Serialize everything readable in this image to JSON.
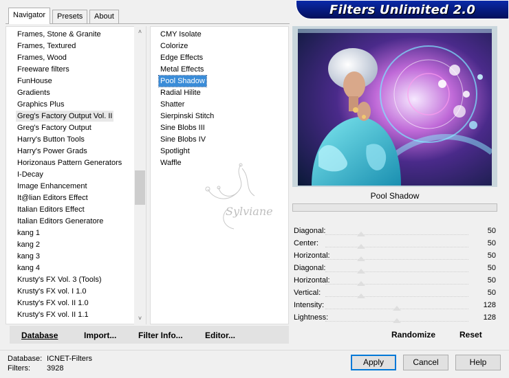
{
  "tabs": [
    {
      "label": "Navigator"
    },
    {
      "label": "Presets"
    },
    {
      "label": "About"
    }
  ],
  "app_title": "Filters Unlimited 2.0",
  "categories": [
    "Frames, Stone & Granite",
    "Frames, Textured",
    "Frames, Wood",
    "Freeware filters",
    "FunHouse",
    "Gradients",
    "Graphics Plus",
    "Greg's Factory Output Vol. II",
    "Greg's Factory Output",
    "Harry's Button Tools",
    "Harry's Power Grads",
    "Horizonaus Pattern Generators",
    "I-Decay",
    "Image Enhancement",
    "It@lian Editors Effect",
    "Italian Editors Effect",
    "Italian Editors Generatore",
    "kang 1",
    "kang 2",
    "kang 3",
    "kang 4",
    "Krusty's FX Vol. 3 (Tools)",
    "Krusty's FX vol. I 1.0",
    "Krusty's FX vol. II 1.0",
    "Krusty's FX vol. II 1.1"
  ],
  "highlighted_category_index": 7,
  "filters": [
    "CMY Isolate",
    "Colorize",
    "Edge Effects",
    "Metal Effects",
    "Pool Shadow",
    "Radial Hilite",
    "Shatter",
    "Sierpinski Stitch",
    "Sine Blobs III",
    "Sine Blobs IV",
    "Spotlight",
    "Waffle"
  ],
  "selected_filter_index": 4,
  "watermark_text": "Sylviane",
  "preview": {
    "filter_name": "Pool Shadow"
  },
  "params": [
    {
      "label": "Diagonal:",
      "value": "50",
      "level": 0.25
    },
    {
      "label": "Center:",
      "value": "50",
      "level": 0.25
    },
    {
      "label": "Horizontal:",
      "value": "50",
      "level": 0.25
    },
    {
      "label": "Diagonal:",
      "value": "50",
      "level": 0.25
    },
    {
      "label": "Horizontal:",
      "value": "50",
      "level": 0.25
    },
    {
      "label": "Vertical:",
      "value": "50",
      "level": 0.25
    },
    {
      "label": "Intensity:",
      "value": "128",
      "level": 0.5
    },
    {
      "label": "Lightness:",
      "value": "128",
      "level": 0.5
    }
  ],
  "randomize_label": "Randomize",
  "reset_label": "Reset",
  "toolbar": {
    "database": "Database",
    "import": "Import...",
    "filter_info": "Filter Info...",
    "editor": "Editor..."
  },
  "footer": {
    "database_label": "Database:",
    "database_value": "ICNET-Filters",
    "filters_label": "Filters:",
    "filters_value": "3928"
  },
  "buttons": {
    "apply": "Apply",
    "cancel": "Cancel",
    "help": "Help"
  },
  "colors": {
    "banner": "#06197a",
    "selection": "#3a8cd8",
    "default_button_border": "#0078d7"
  }
}
